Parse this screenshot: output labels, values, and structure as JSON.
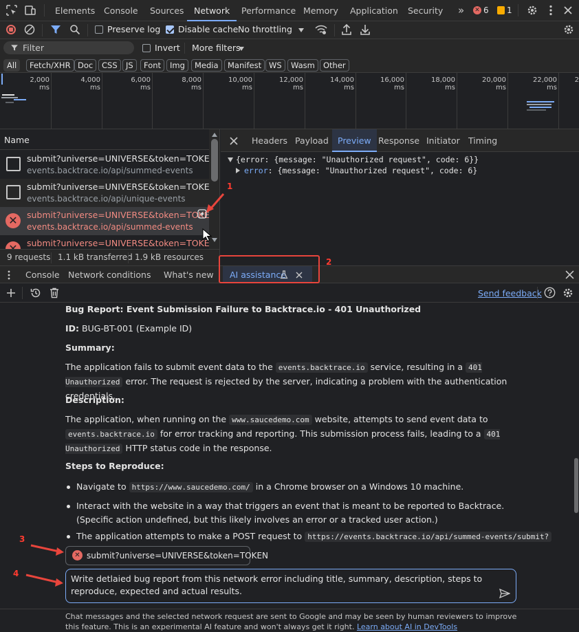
{
  "topbar": {
    "tabs": [
      "Elements",
      "Console",
      "Sources",
      "Network",
      "Performance",
      "Memory",
      "Application",
      "Security"
    ],
    "active_tab": "Network",
    "more": "»",
    "errors": "6",
    "warnings": "1"
  },
  "toolbar": {
    "preserve_log": "Preserve log",
    "disable_cache": "Disable cache",
    "throttling": "No throttling"
  },
  "filterbar": {
    "filter_placeholder": "Filter",
    "invert": "Invert",
    "more_filters": "More filters"
  },
  "type_filters": [
    "All",
    "Fetch/XHR",
    "Doc",
    "CSS",
    "JS",
    "Font",
    "Img",
    "Media",
    "Manifest",
    "WS",
    "Wasm",
    "Other"
  ],
  "timeline": {
    "ticks": [
      "2,000 ms",
      "4,000 ms",
      "6,000 ms",
      "8,000 ms",
      "10,000 ms",
      "12,000 ms",
      "14,000 ms",
      "16,000 ms",
      "18,000 ms",
      "20,000 ms",
      "22,000 ms",
      "2"
    ]
  },
  "requests": {
    "header": "Name",
    "items": [
      {
        "name": "submit?universe=UNIVERSE&token=TOKEN",
        "url": "events.backtrace.io/api/summed-events",
        "status": "ok"
      },
      {
        "name": "submit?universe=UNIVERSE&token=TOKEN",
        "url": "events.backtrace.io/api/unique-events",
        "status": "ok"
      },
      {
        "name": "submit?universe=UNIVERSE&token=TOKEN",
        "url": "events.backtrace.io/api/summed-events",
        "status": "error"
      },
      {
        "name": "submit?universe=UNIVERSE&token=TOKEN",
        "url": "",
        "status": "error"
      }
    ]
  },
  "status": {
    "requests": "9 requests",
    "transferred": "1.1 kB transferred",
    "resources": "1.9 kB resources"
  },
  "detail": {
    "tabs": [
      "Headers",
      "Payload",
      "Preview",
      "Response",
      "Initiator",
      "Timing"
    ],
    "active_tab": "Preview",
    "preview_line1": "{error: {message: \"Unauthorized request\", code: 6}}",
    "preview_key": "error",
    "preview_line2": ": {message: \"Unauthorized request\", code: 6}"
  },
  "drawer": {
    "tabs": [
      "Console",
      "Network conditions",
      "What's new",
      "AI assistance"
    ],
    "active_tab": "AI assistance"
  },
  "ai": {
    "send_feedback": "Send feedback",
    "title": "Bug Report: Event Submission Failure to Backtrace.io - 401 Unauthorized",
    "id_label": "ID:",
    "id_value": " BUG-BT-001 (Example ID)",
    "summary_heading": "Summary:",
    "summary_1": "The application fails to submit event data to the ",
    "summary_code1": "events.backtrace.io",
    "summary_2": " service, resulting in a ",
    "summary_code2": "401 Unauthorized",
    "summary_3": " error. The request is rejected by the server, indicating a problem with the authentication credentials.",
    "description_heading": "Description:",
    "desc_1": "The application, when running on the ",
    "desc_code1": "www.saucedemo.com",
    "desc_2": " website, attempts to send event data to ",
    "desc_code2": "events.backtrace.io",
    "desc_3": " for error tracking and reporting. This submission process fails, leading to a ",
    "desc_code3": "401 Unauthorized",
    "desc_4": " HTTP status code in the response.",
    "steps_heading": "Steps to Reproduce:",
    "step1_a": "Navigate to ",
    "step1_code": "https://www.saucedemo.com/",
    "step1_b": " in a Chrome browser on a Windows 10 machine.",
    "step2": "Interact with the website in a way that triggers an event that is meant to be reported to Backtrace. (Specific action undefined, but this likely involves an error or a tracked user action.)",
    "step3_a": "The application attempts to make a POST request to ",
    "step3_code": "https://events.backtrace.io/api/summed-events/submit?",
    "context_chip": "submit?universe=UNIVERSE&token=TOKEN",
    "prompt": "Write detlaied bug report from this network error including title, summary, description, steps to reproduce, expected and actual results.",
    "disclaimer": "Chat messages and the selected network request are sent to Google and may be seen by human reviewers to improve this feature. This is an experimental AI feature and won't always get it right. ",
    "learn_link": "Learn about AI in DevTools"
  },
  "callouts": [
    "1",
    "2",
    "3",
    "4"
  ],
  "colors": {
    "accent": "#7cacf8",
    "error": "#e46962",
    "annotation": "#e8453c"
  }
}
